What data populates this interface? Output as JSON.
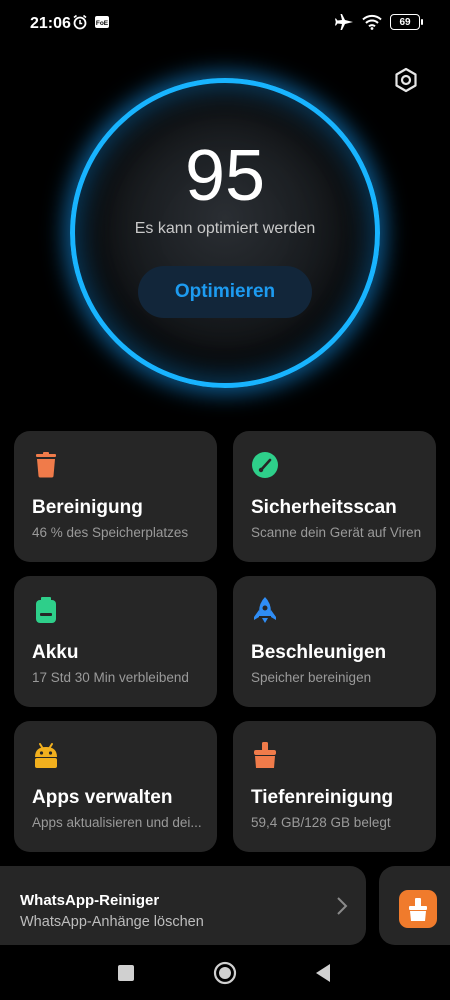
{
  "status_bar": {
    "time": "21:06",
    "left_icons": [
      "alarm-icon",
      "notification-badge-icon"
    ],
    "right_icons": [
      "airplane-icon",
      "wifi-icon"
    ],
    "battery_level": "69"
  },
  "score": {
    "value": "95",
    "subtitle": "Es kann optimiert werden",
    "button_label": "Optimieren",
    "ring_color": "#18b4ff"
  },
  "cards": [
    {
      "title": "Bereinigung",
      "subtitle": "46 % des Speicherplatzes",
      "icon": "trash-icon",
      "color": "#f07b4a"
    },
    {
      "title": "Sicherheitsscan",
      "subtitle": "Scanne dein Gerät auf Viren",
      "icon": "shield-gauge-icon",
      "color": "#2ecf8a"
    },
    {
      "title": "Akku",
      "subtitle": "17 Std 30 Min  verbleibend",
      "icon": "battery-icon",
      "color": "#2ecf8a"
    },
    {
      "title": "Beschleunigen",
      "subtitle": "Speicher bereinigen",
      "icon": "rocket-icon",
      "color": "#2f8df5"
    },
    {
      "title": "Apps verwalten",
      "subtitle": "Apps aktualisieren und dei...",
      "icon": "android-icon",
      "color": "#f2b01e"
    },
    {
      "title": "Tiefenreinigung",
      "subtitle": "59,4 GB/128 GB belegt",
      "icon": "broom-icon",
      "color": "#f07b4a"
    }
  ],
  "banner": {
    "title": "WhatsApp-Reiniger",
    "subtitle": "WhatsApp-Anhänge löschen"
  },
  "navbar": {
    "buttons": [
      "recents-button",
      "home-button",
      "back-button"
    ]
  }
}
